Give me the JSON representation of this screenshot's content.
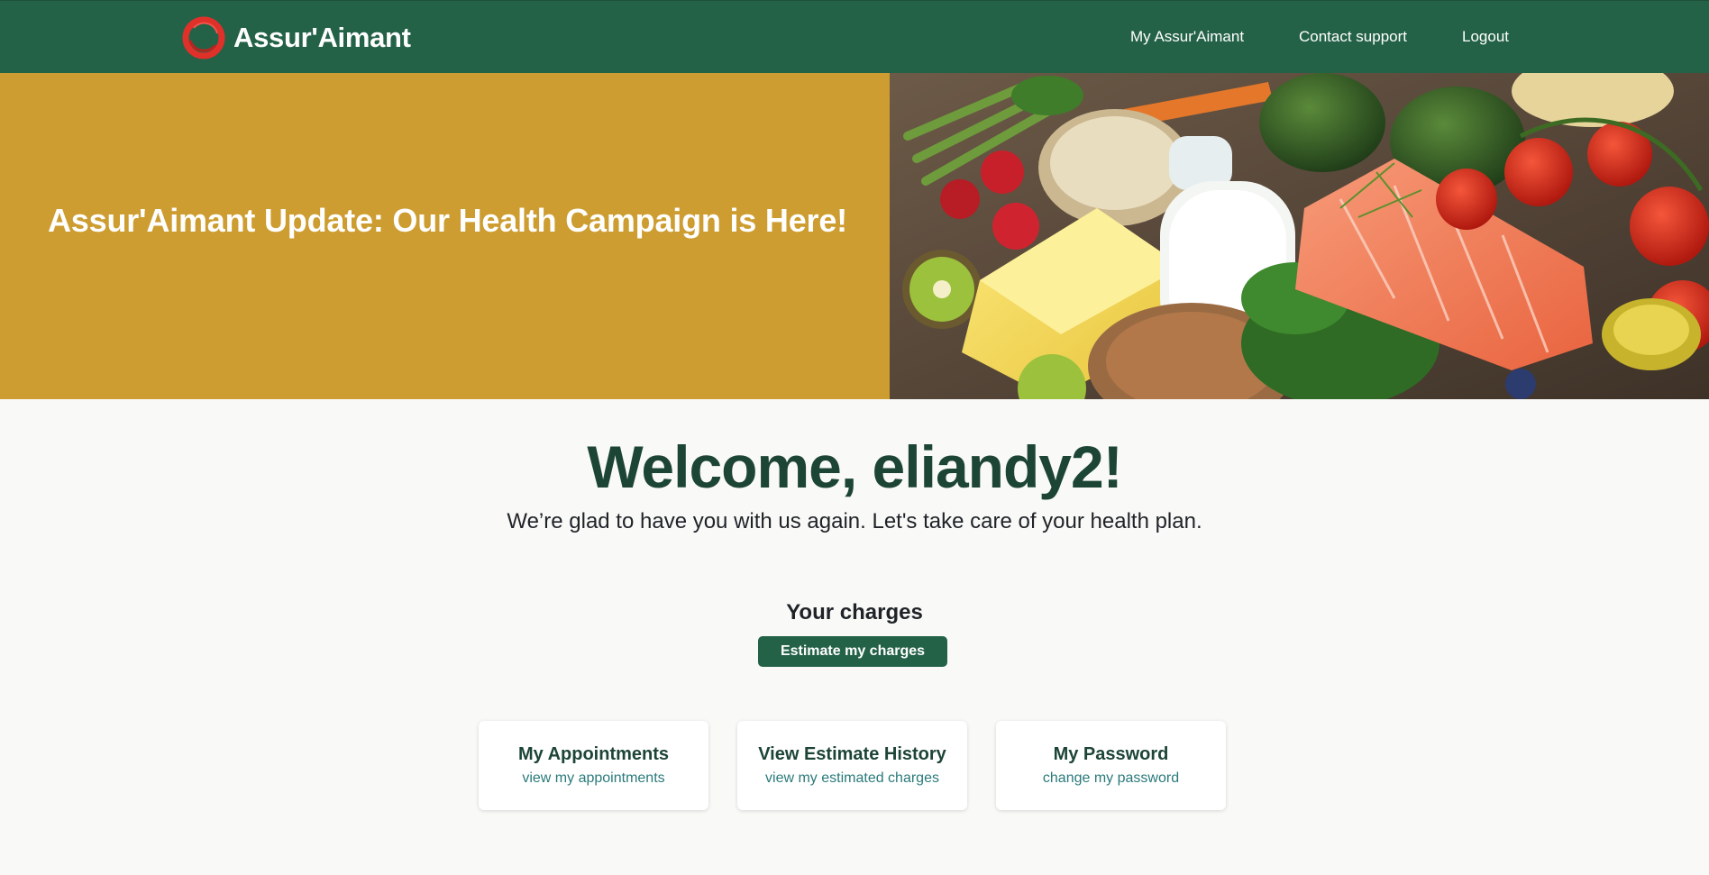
{
  "navbar": {
    "brand_name": "Assur'Aimant",
    "links": [
      {
        "label": "My Assur'Aimant"
      },
      {
        "label": "Contact support"
      },
      {
        "label": "Logout"
      }
    ]
  },
  "hero": {
    "title": "Assur'Aimant Update: Our Health Campaign is Here!",
    "image_subject": "healthy-food-assortment"
  },
  "main": {
    "welcome": "Welcome, eliandy2!",
    "subtitle": "We’re glad to have you with us again. Let's take care of your health plan.",
    "charges_title": "Your charges",
    "estimate_button": "Estimate my charges"
  },
  "cards": [
    {
      "title": "My Appointments",
      "link": "view my appointments"
    },
    {
      "title": "View Estimate History",
      "link": "view my estimated charges"
    },
    {
      "title": "My Password",
      "link": "change my password"
    }
  ],
  "colors": {
    "nav_bg": "#246248",
    "hero_bg": "#cd9d31",
    "heading": "#1d4536",
    "link": "#2b7a7a",
    "logo_red": "#e0302a"
  }
}
